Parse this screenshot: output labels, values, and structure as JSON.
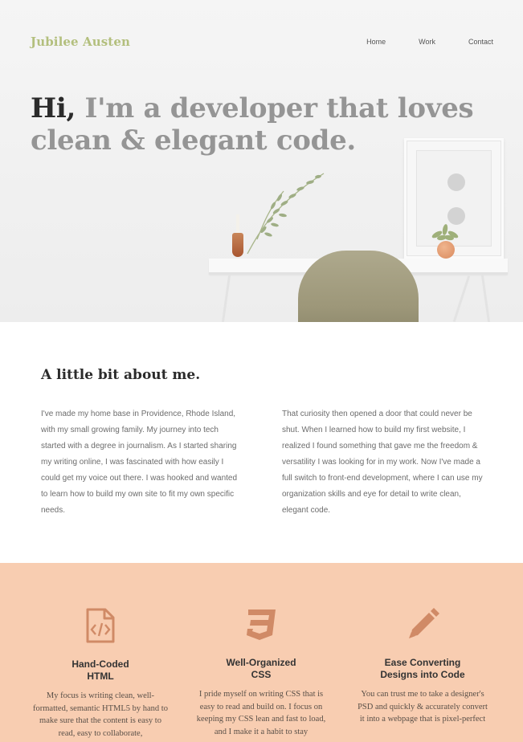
{
  "header": {
    "brand": "Jubilee Austen",
    "nav": [
      "Home",
      "Work",
      "Contact"
    ]
  },
  "hero": {
    "greeting": "Hi,",
    "headline": "I'm a developer that loves clean & elegant code."
  },
  "about": {
    "title": "A little bit about me.",
    "paragraphs": [
      "I've made my home base in Providence, Rhode Island, with my small growing family. My journey into tech started with a degree in journalism. As I started sharing my writing online, I was fascinated with how easily I could get my voice out there. I was hooked and wanted to learn how to build my own site to fit my own specific needs.",
      "That curiosity then opened a door that could never be shut. When I learned how to build my first website, I realized I found something that gave me the freedom & versatility I was looking for in my work. Now I've made a full switch to front-end development, where I can use my organization skills and eye for detail to write clean, elegant code."
    ]
  },
  "skills": [
    {
      "icon": "html-file-icon",
      "title_line1": "Hand-Coded",
      "title_line2": "HTML",
      "text": "My focus is writing clean, well-formatted, semantic HTML5 by hand to make sure that the content is easy to read, easy to collaborate,"
    },
    {
      "icon": "css3-icon",
      "title_line1": "Well-Organized",
      "title_line2": "CSS",
      "text": "I pride myself on writing CSS that is easy to read and build on. I focus on keeping my CSS lean and fast to load, and I make it a habit to stay"
    },
    {
      "icon": "pencil-icon",
      "title_line1": "Ease Converting",
      "title_line2": "Designs into Code",
      "text": "You can trust me to take a designer's PSD and quickly & accurately convert it into a webpage that is pixel-perfect"
    }
  ],
  "colors": {
    "brand": "#b3bf7d",
    "skills_bg": "#f8cdb1",
    "icon": "#d08a66"
  }
}
